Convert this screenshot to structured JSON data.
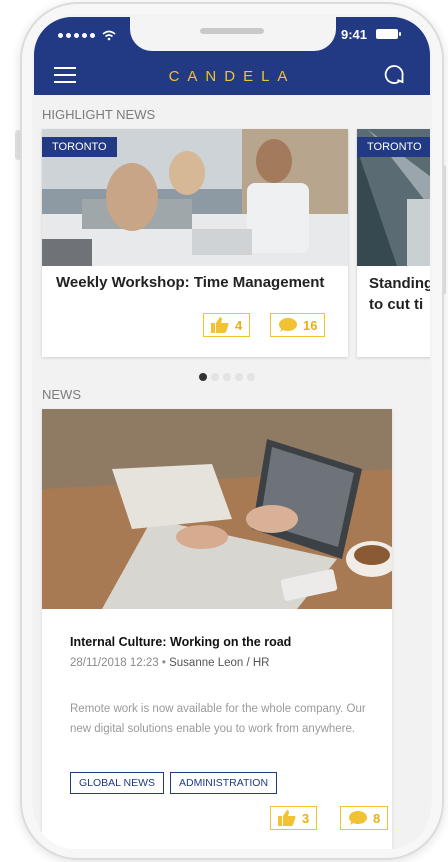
{
  "status": {
    "time": "9:41"
  },
  "header": {
    "brand": "CANDELA"
  },
  "highlight": {
    "section_title": "HIGHLIGHT NEWS",
    "cards": [
      {
        "city": "TORONTO",
        "title": "Weekly Workshop: Time Management",
        "likes": "4",
        "comments": "16"
      },
      {
        "city": "TORONTO",
        "title_line1": "Standing",
        "title_line2": "to cut ti"
      }
    ],
    "pages": 5,
    "active_page": 1
  },
  "news": {
    "section_title": "NEWS",
    "item": {
      "title": "Internal Culture: Working on the road",
      "date": "28/11/2018 12:23",
      "author": "Susanne Leon / HR",
      "body": "Remote work  is now available for the whole company. Our new digital solutions enable you to work from anywhere.",
      "tags": [
        "GLOBAL NEWS",
        "ADMINISTRATION"
      ],
      "likes": "3",
      "comments": "8"
    }
  },
  "colors": {
    "primary": "#213a83",
    "accent": "#f1c232"
  }
}
